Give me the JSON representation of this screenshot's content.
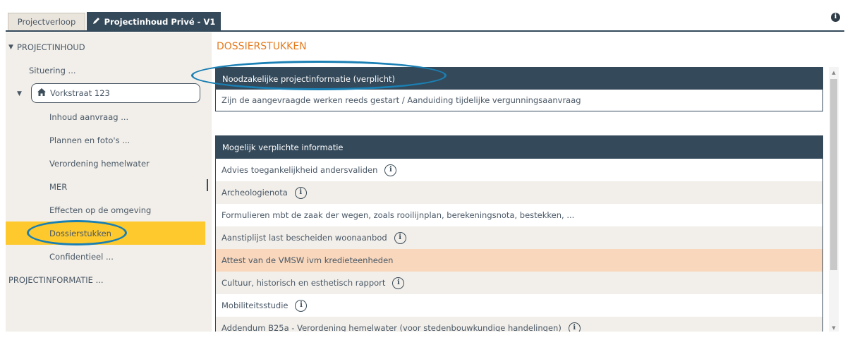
{
  "tabs": [
    {
      "label": "Projectverloop",
      "active": false
    },
    {
      "label": "Projectinhoud Privé - V1",
      "active": true,
      "icon": "pencil-icon"
    }
  ],
  "info_icon": "i",
  "sidebar": {
    "root_label": "PROJECTINHOUD",
    "items": [
      {
        "label": "Situering ..."
      },
      {
        "label": "Vorkstraat 123",
        "icon": "home-icon"
      },
      {
        "label": "Inhoud aanvraag ..."
      },
      {
        "label": "Plannen en foto's ..."
      },
      {
        "label": "Verordening hemelwater"
      },
      {
        "label": "MER"
      },
      {
        "label": "Effecten op de omgeving"
      },
      {
        "label": "Dossierstukken",
        "active": true
      },
      {
        "label": "Confidentieel ..."
      }
    ],
    "footer_label": "PROJECTINFORMATIE ..."
  },
  "main": {
    "title": "DOSSIERSTUKKEN",
    "panel1": {
      "header": "Noodzakelijke projectinformatie (verplicht)",
      "rows": [
        "Zijn de aangevraagde werken reeds gestart / Aanduiding tijdelijke vergunningsaanvraag"
      ]
    },
    "panel2": {
      "header": "Mogelijk verplichte informatie",
      "rows": [
        {
          "label": "Advies toegankelijkheid andersvaliden",
          "info": true
        },
        {
          "label": "Archeologienota",
          "info": true
        },
        {
          "label": "Formulieren mbt de zaak der wegen, zoals rooilijnplan, berekeningsnota, bestekken, ...",
          "info": false
        },
        {
          "label": "Aanstiplijst last bescheiden woonaanbod",
          "info": true
        },
        {
          "label": "Attest van de VMSW ivm kredieteenheden",
          "info": false
        },
        {
          "label": "Cultuur, historisch en esthetisch rapport",
          "info": true
        },
        {
          "label": "Mobiliteitsstudie",
          "info": true
        },
        {
          "label": "Addendum B25a - Verordening hemelwater (voor stedenbouwkundige handelingen)",
          "info": true
        }
      ]
    }
  },
  "colors": {
    "dark": "#34495a",
    "accent": "#e57b1f",
    "active": "#fdc92d",
    "highlight": "#f9d7bc",
    "annotation": "#1a7fb3"
  }
}
